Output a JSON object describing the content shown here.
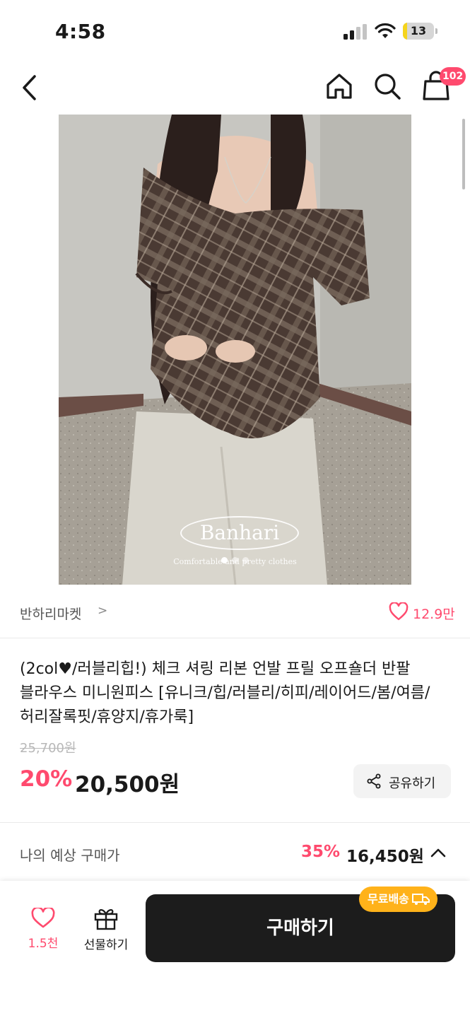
{
  "status_bar": {
    "time": "4:58",
    "battery": "13",
    "battery_fraction": 0.13
  },
  "nav": {
    "cart_badge": "102"
  },
  "product_image": {
    "logo": "Banhari",
    "tagline": "Comfortable and pretty clothes",
    "slide_count": 3,
    "active_slide": 1
  },
  "store": {
    "name": "반하리마켓",
    "chevron": ">",
    "likes": "12.9만"
  },
  "product": {
    "title": "(2col♥/러블리힙!) 체크 셔링 리본 언발 프릴 오프숄더 반팔 블라우스 미니원피스 [유니크/힙/러블리/히피/레이어드/봄/여름/허리잘록핏/휴양지/휴가룩]",
    "original_price": "25,700원",
    "discount": "20%",
    "price": "20,500원",
    "share_label": "공유하기"
  },
  "expected": {
    "label": "나의 예상 구매가",
    "discount": "35%",
    "price": "16,450원"
  },
  "bottom_bar": {
    "wish_count": "1.5천",
    "gift_label": "선물하기",
    "buy_label": "구매하기",
    "free_shipping": "무료배송"
  },
  "colors": {
    "accent": "#ff4a6e",
    "buy_button": "#1c1c1c",
    "free_shipping_badge": "#ffb21a"
  }
}
